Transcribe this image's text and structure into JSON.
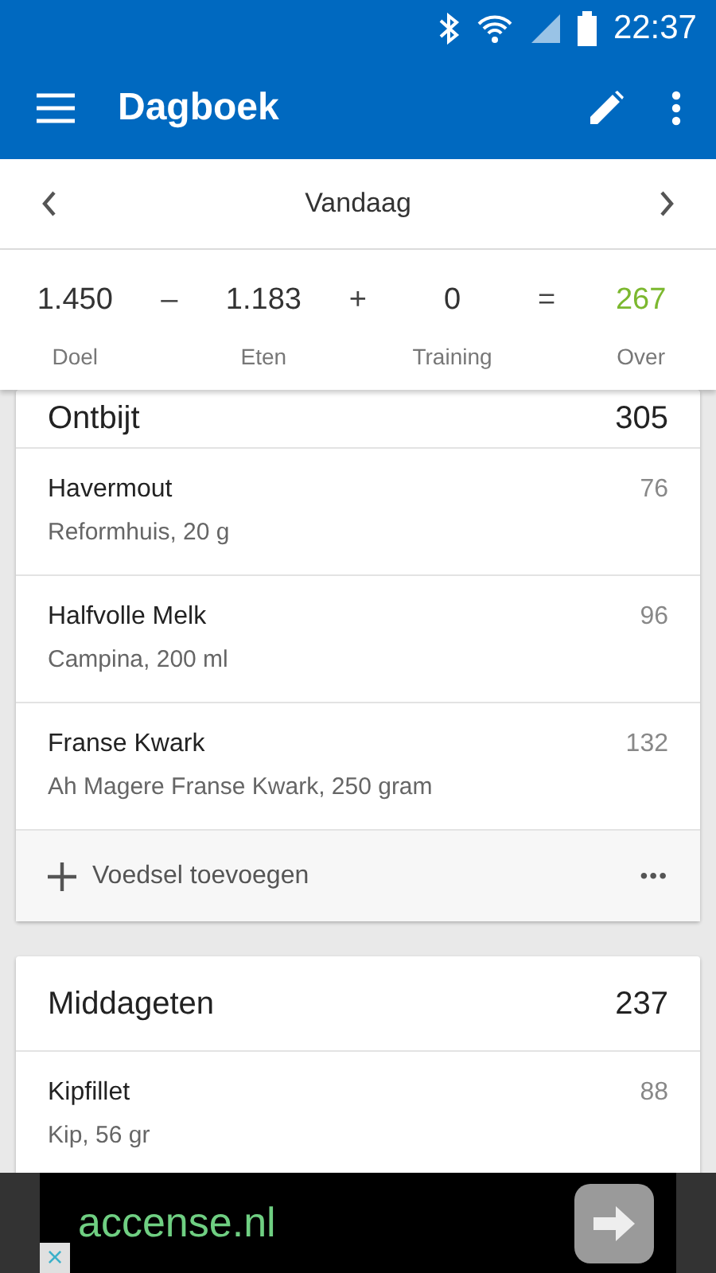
{
  "status_bar": {
    "time": "22:37"
  },
  "app_bar": {
    "title": "Dagboek"
  },
  "date_nav": {
    "label": "Vandaag"
  },
  "summary": {
    "items": [
      {
        "value": "1.450",
        "label": "Doel",
        "color": "#333333"
      },
      {
        "value": "1.183",
        "label": "Eten",
        "color": "#333333"
      },
      {
        "value": "0",
        "label": "Training",
        "color": "#333333"
      },
      {
        "value": "267",
        "label": "Over",
        "color": "#7cb82f"
      }
    ],
    "operators": [
      "–",
      "+",
      "="
    ]
  },
  "meals": [
    {
      "name": "Ontbijt",
      "total": "305",
      "foods": [
        {
          "name": "Havermout",
          "detail": "Reformhuis, 20 g",
          "calories": "76"
        },
        {
          "name": "Halfvolle Melk",
          "detail": "Campina, 200 ml",
          "calories": "96"
        },
        {
          "name": "Franse Kwark",
          "detail": "Ah Magere Franse Kwark, 250 gram",
          "calories": "132"
        }
      ],
      "add_label": "Voedsel toevoegen",
      "more": "•••"
    },
    {
      "name": "Middageten",
      "total": "237",
      "foods": [
        {
          "name": "Kipfillet",
          "detail": "Kip, 56 gr",
          "calories": "88"
        }
      ]
    }
  ],
  "ad": {
    "text": "accense.nl",
    "close": "×"
  }
}
